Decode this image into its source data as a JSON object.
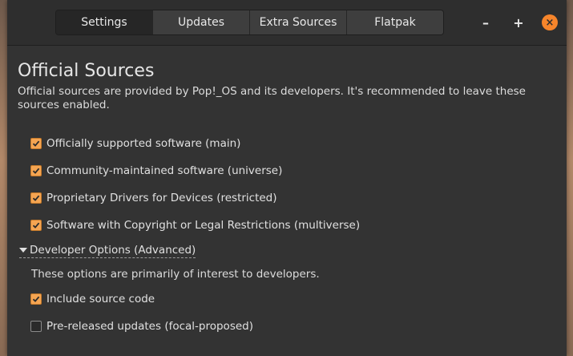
{
  "tabs": [
    {
      "label": "Settings",
      "active": true
    },
    {
      "label": "Updates",
      "active": false
    },
    {
      "label": "Extra Sources",
      "active": false
    },
    {
      "label": "Flatpak",
      "active": false
    }
  ],
  "window_controls": {
    "minimize": "–",
    "maximize": "+",
    "close": "×"
  },
  "official": {
    "title": "Official Sources",
    "description": "Official sources are provided by Pop!_OS and its developers. It's recommended to leave these sources enabled.",
    "options": [
      {
        "label": "Officially supported software (main)",
        "checked": true
      },
      {
        "label": "Community-maintained software (universe)",
        "checked": true
      },
      {
        "label": "Proprietary Drivers for Devices (restricted)",
        "checked": true
      },
      {
        "label": "Software with Copyright or Legal Restrictions (multiverse)",
        "checked": true
      }
    ]
  },
  "developer": {
    "expander_label": "Developer Options (Advanced)",
    "description": "These options are primarily of interest to developers.",
    "options": [
      {
        "label": "Include source code",
        "checked": true
      },
      {
        "label": "Pre-released updates (focal-proposed)",
        "checked": false
      }
    ]
  },
  "colors": {
    "accent": "#f5a552",
    "close_button": "#f6852b",
    "window_bg": "#333333",
    "headerbar_bg": "#2e2e2e"
  }
}
